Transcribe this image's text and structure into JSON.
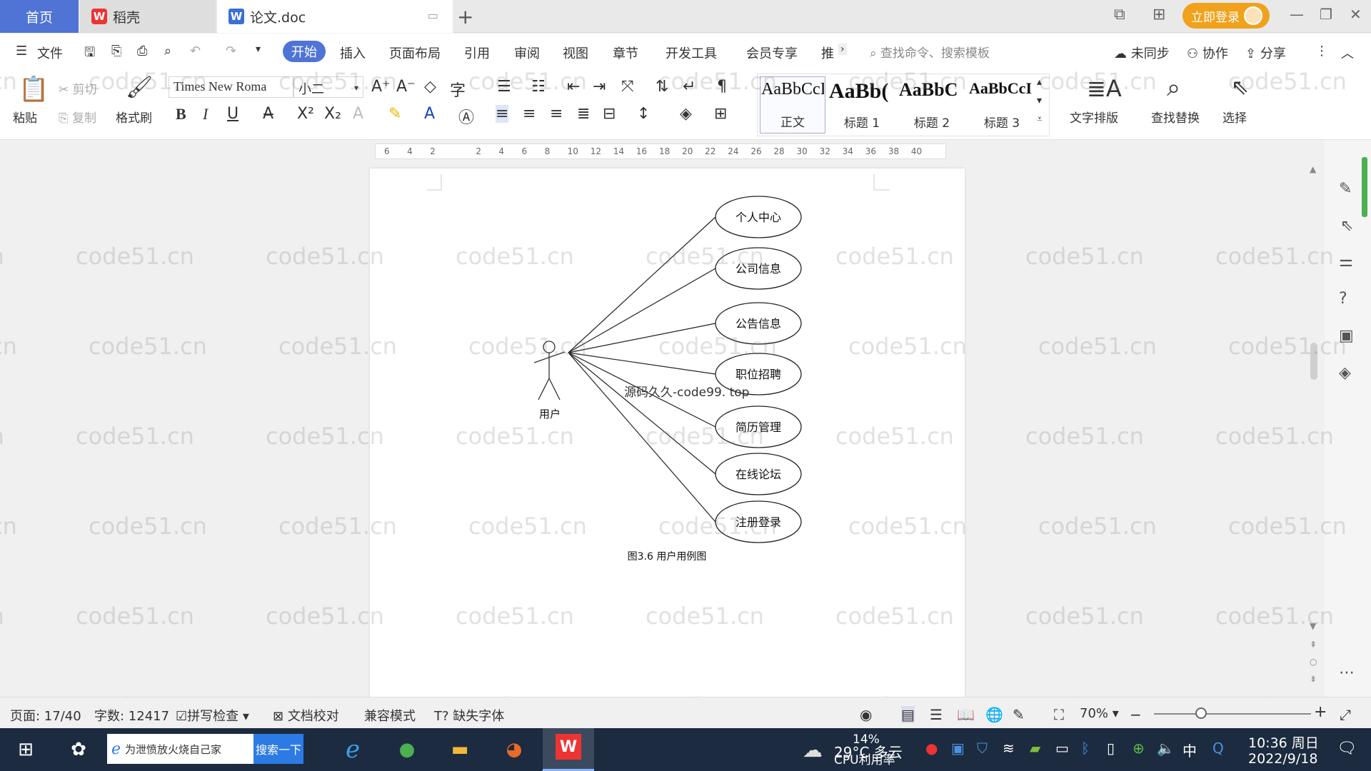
{
  "tabs": {
    "home": "首页",
    "docer": "稻壳",
    "doc": "论文.doc"
  },
  "window": {
    "login": "立即登录"
  },
  "menubar": {
    "file": "文件",
    "items": [
      "开始",
      "插入",
      "页面布局",
      "引用",
      "审阅",
      "视图",
      "章节",
      "开发工具",
      "会员专享",
      "推"
    ],
    "search_cmd": "查找命令、搜索模板",
    "sync": "未同步",
    "collab": "协作",
    "share": "分享"
  },
  "ribbon": {
    "paste": "粘贴",
    "cut": "剪切",
    "copy": "复制",
    "format_painter": "格式刷",
    "font_name": "Times New Roma",
    "font_size": "小二",
    "styles": [
      {
        "sample": "AaBbCcI",
        "label": "正文"
      },
      {
        "sample": "AaBb(",
        "label": "标题 1"
      },
      {
        "sample": "AaBbC",
        "label": "标题 2"
      },
      {
        "sample": "AaBbCcI",
        "label": "标题 3"
      }
    ],
    "text_layout": "文字排版",
    "find_replace": "查找替换",
    "select": "选择"
  },
  "ruler": {
    "ticks": [
      "6",
      "4",
      "2",
      "",
      "2",
      "4",
      "6",
      "8",
      "10",
      "12",
      "14",
      "16",
      "18",
      "20",
      "22",
      "24",
      "26",
      "28",
      "30",
      "32",
      "34",
      "36",
      "38",
      "40"
    ]
  },
  "diagram": {
    "actor": "用户",
    "use_cases": [
      "个人中心",
      "公司信息",
      "公告信息",
      "职位招聘",
      "简历管理",
      "在线论坛",
      "注册登录"
    ],
    "overlay_text": "源码久久-code99. top",
    "caption": "图3.6 用户用例图"
  },
  "watermark": "code51.cn",
  "status": {
    "page": "页面: 17/40",
    "words": "字数: 12417",
    "spell": "拼写检查",
    "proof": "文档校对",
    "compat": "兼容模式",
    "missing_font": "缺失字体",
    "zoom": "70%"
  },
  "taskbar": {
    "search_text": "为泄愤放火烧自己家",
    "search_btn": "搜索一下",
    "weather": "29°C 多云",
    "cpu": "14%",
    "cpu_label": "CPU利用率",
    "ime": "中",
    "time": "10:36 周日",
    "date": "2022/9/18"
  },
  "colors": {
    "accent": "#4f74d6",
    "login": "#f0a21c",
    "taskbar": "#1c2b3f"
  }
}
